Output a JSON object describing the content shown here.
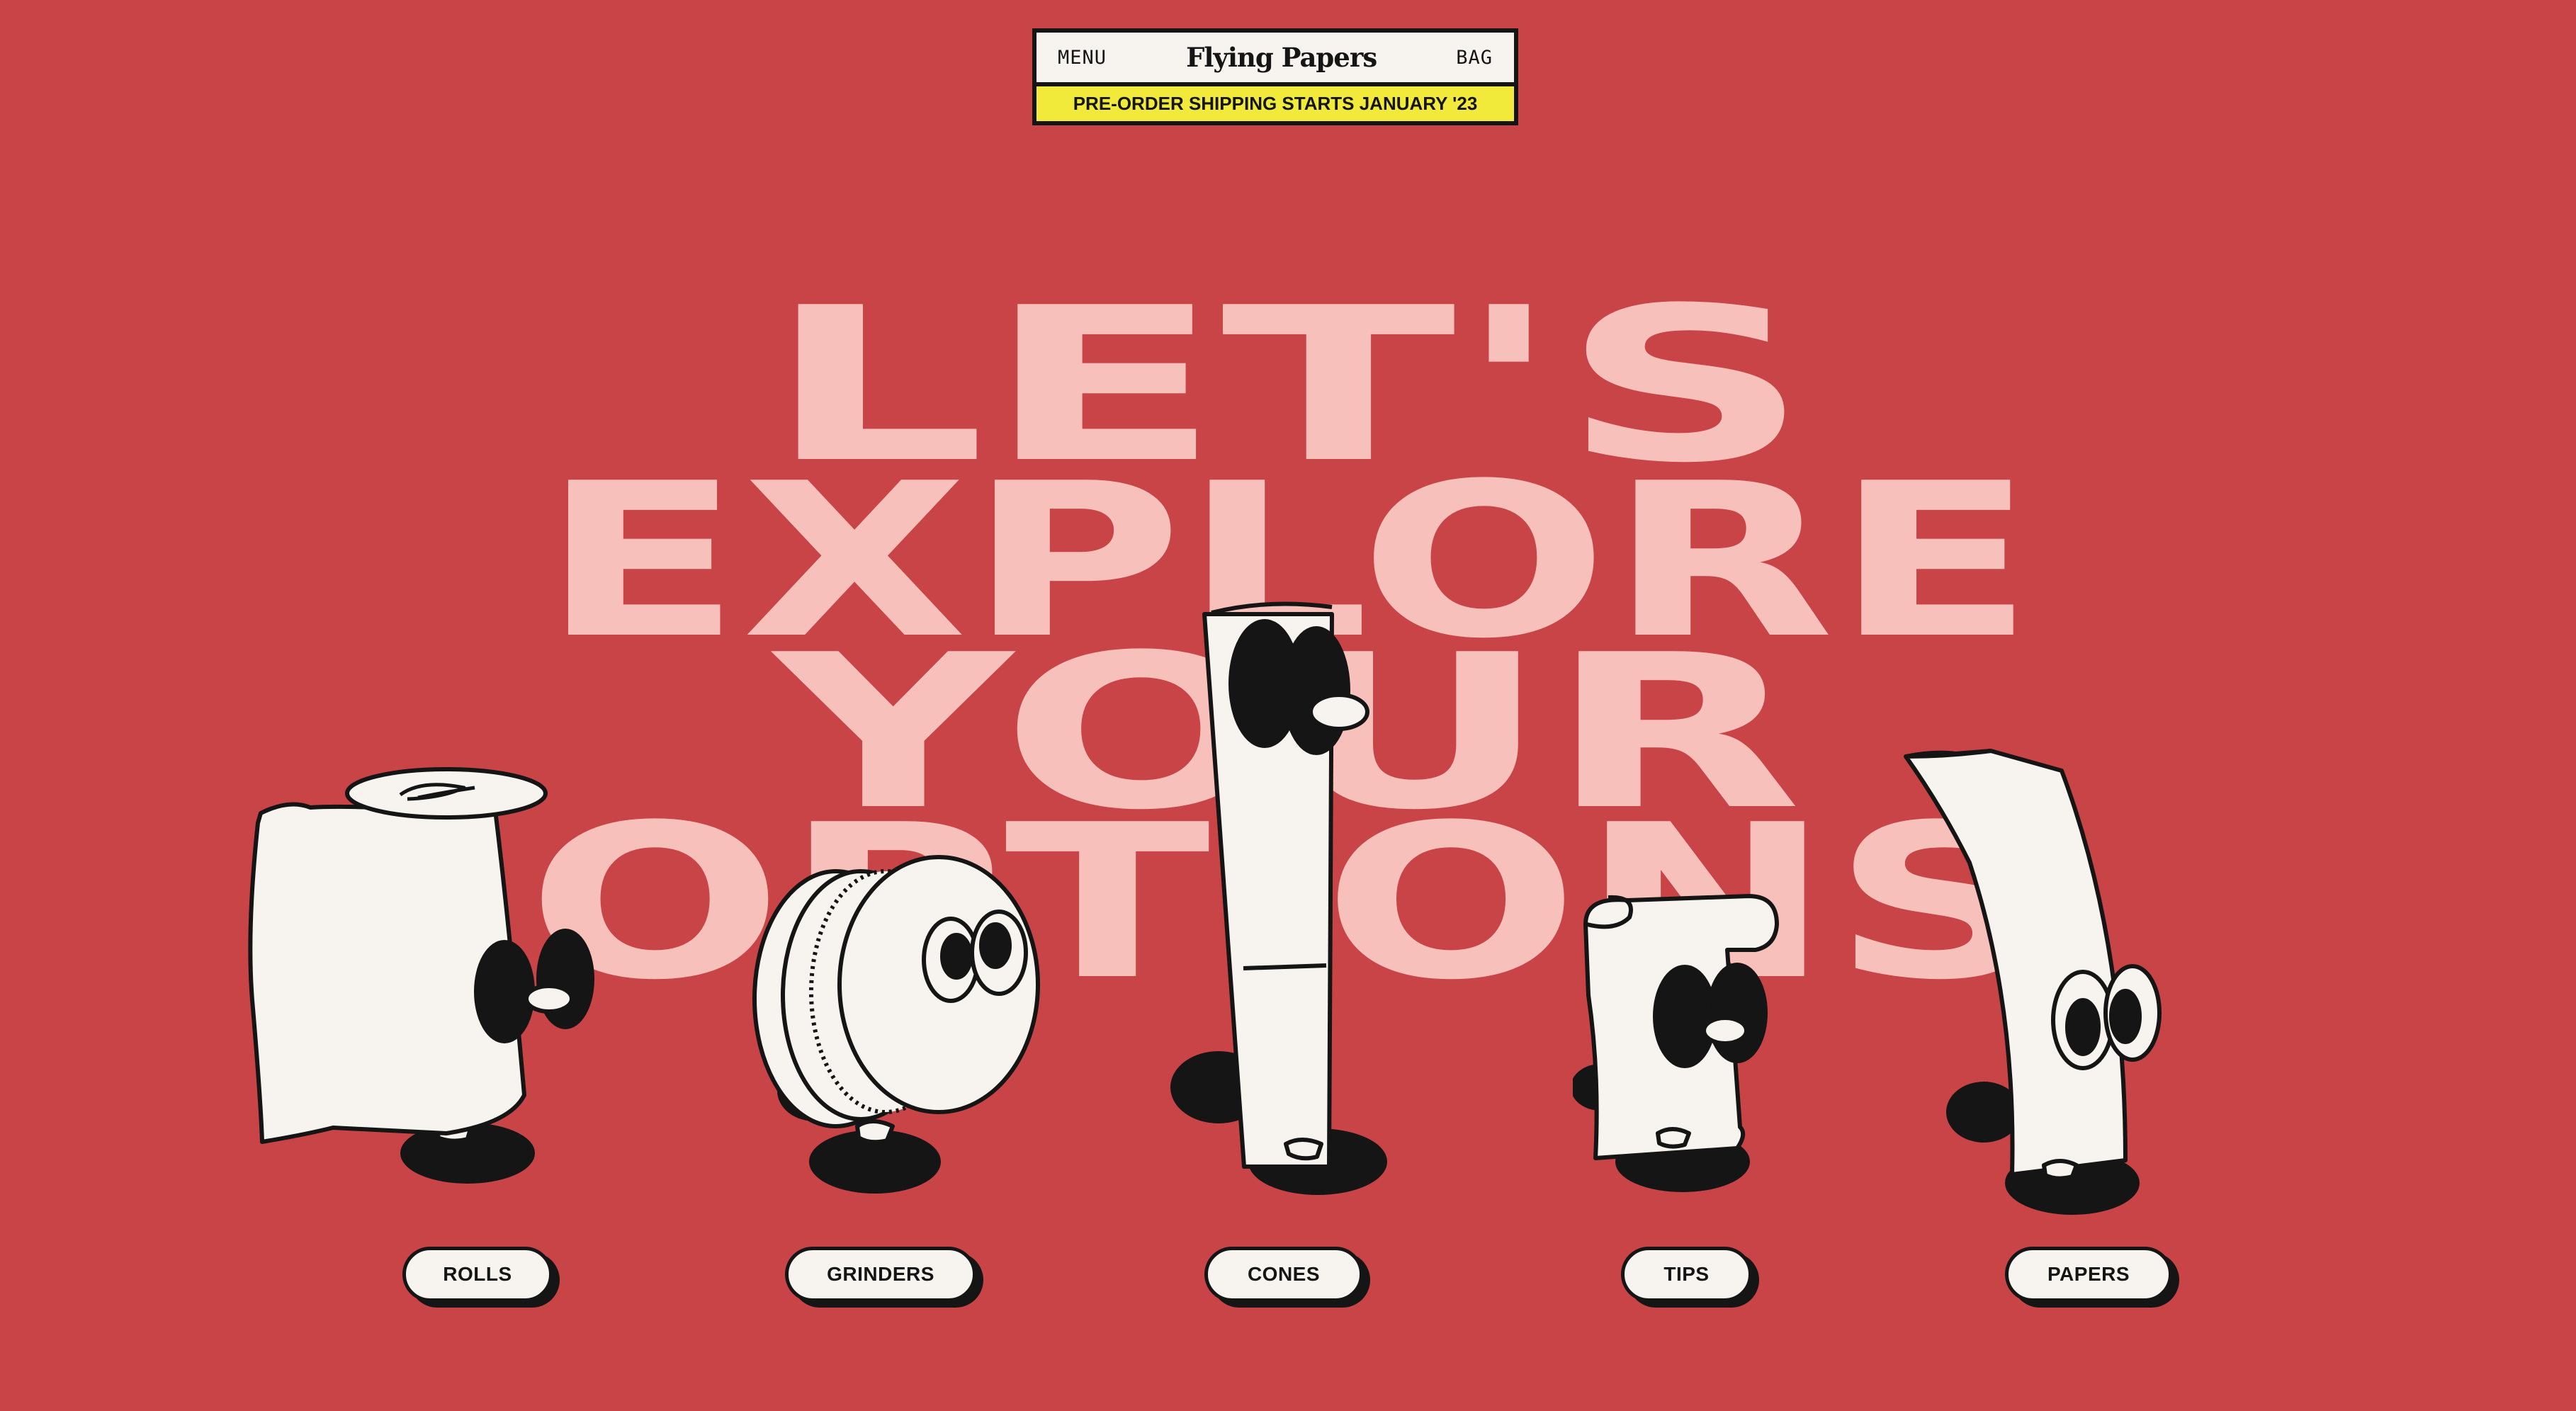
{
  "header": {
    "menu_label": "MENU",
    "brand": "Flying Papers",
    "bag_label": "BAG",
    "promo": "PRE-ORDER SHIPPING STARTS JANUARY '23"
  },
  "headline": {
    "line1": "LET'S",
    "line2": "EXPLORE",
    "line3": "YOUR",
    "line4": "OPTIONS"
  },
  "categories": [
    {
      "label": "ROLLS",
      "icon": "rolls-character-icon"
    },
    {
      "label": "GRINDERS",
      "icon": "grinder-character-icon"
    },
    {
      "label": "CONES",
      "icon": "cone-character-icon"
    },
    {
      "label": "TIPS",
      "icon": "tips-character-icon"
    },
    {
      "label": "PAPERS",
      "icon": "papers-character-icon"
    }
  ],
  "colors": {
    "background": "#c94447",
    "headline": "#f7c0bb",
    "promo_bar": "#f2ea3a",
    "ink": "#151515",
    "paper": "#f7f4ef"
  }
}
